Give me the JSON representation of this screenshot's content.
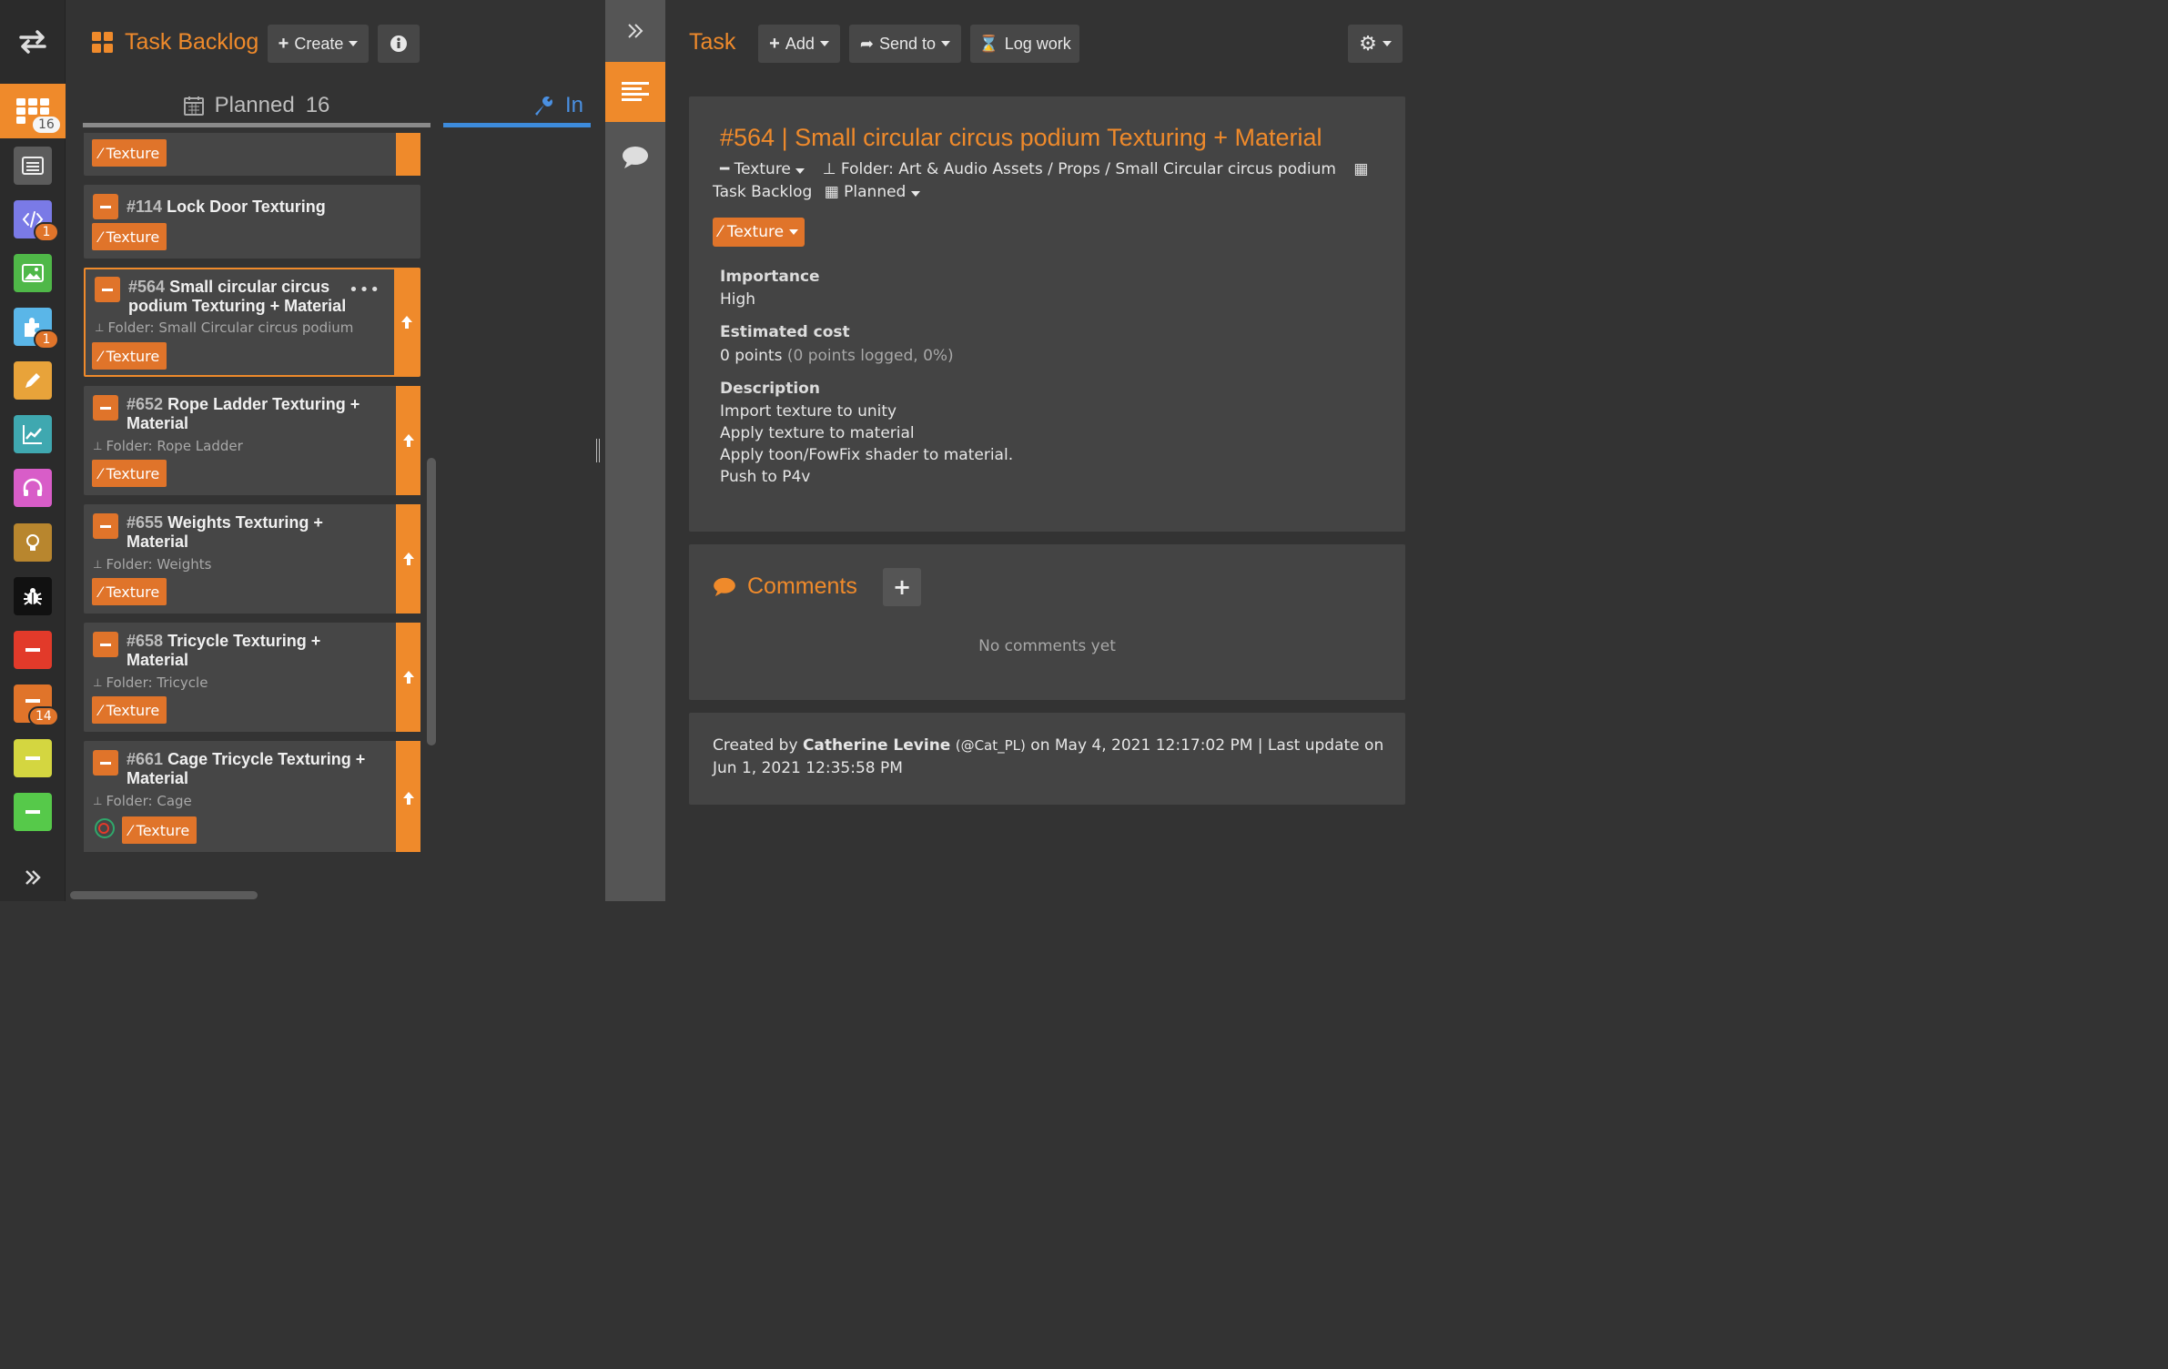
{
  "rail": {
    "badges": {
      "backlog": "16",
      "code": "1",
      "plugins": "1",
      "orange_task": "14"
    },
    "colors": [
      "#ef8a2b",
      "#5c5c5c",
      "#7a7ae6",
      "#4fb848",
      "#5ab6e8",
      "#e8a33a",
      "#3fa8b0",
      "#d85dc8",
      "#b8862e",
      "#111111",
      "#e23a2a",
      "#e0742a",
      "#d4d640",
      "#56c94a"
    ]
  },
  "backlog": {
    "title": "Task Backlog",
    "create_label": "Create",
    "tabs": {
      "planned_label": "Planned",
      "planned_count": "16",
      "in_label": "In"
    },
    "cards": [
      {
        "num": "",
        "title": "",
        "folder": "",
        "tag": "Texture"
      },
      {
        "num": "#114",
        "title": "Lock Door Texturing",
        "folder": "",
        "tag": "Texture"
      },
      {
        "num": "#564",
        "title": "Small circular circus podium Texturing + Material",
        "folder": "Folder: Small Circular circus podium",
        "tag": "Texture"
      },
      {
        "num": "#652",
        "title": "Rope Ladder Texturing + Material",
        "folder": "Folder: Rope Ladder",
        "tag": "Texture"
      },
      {
        "num": "#655",
        "title": "Weights Texturing + Material",
        "folder": "Folder: Weights",
        "tag": "Texture"
      },
      {
        "num": "#658",
        "title": "Tricycle Texturing + Material",
        "folder": "Folder: Tricycle",
        "tag": "Texture"
      },
      {
        "num": "#661",
        "title": "Cage Tricycle Texturing + Material",
        "folder": "Folder: Cage",
        "tag": "Texture"
      }
    ]
  },
  "detail": {
    "title": "Task",
    "add_label": "Add",
    "send_label": "Send to",
    "log_label": "Log work",
    "task_heading": "#564 | Small circular circus podium Texturing + Material",
    "meta": {
      "type": "Texture",
      "folder": "Folder: Art & Audio Assets / Props / Small Circular circus podium",
      "board": "Task Backlog",
      "status": "Planned"
    },
    "tag": "Texture",
    "importance_label": "Importance",
    "importance_value": "High",
    "cost_label": "Estimated cost",
    "cost_value": "0 points",
    "cost_note": "(0 points logged, 0%)",
    "description_label": "Description",
    "description_lines": [
      "Import texture to unity",
      "Apply texture to material",
      "Apply toon/FowFix shader to material.",
      "Push to P4v"
    ],
    "comments_title": "Comments",
    "no_comments": "No comments yet",
    "footer": {
      "created_prefix": "Created by",
      "author": "Catherine Levine",
      "handle": "(@Cat_PL)",
      "created_suffix": "on May 4, 2021 12:17:02 PM | Last update on Jun 1, 2021 12:35:58 PM"
    }
  }
}
